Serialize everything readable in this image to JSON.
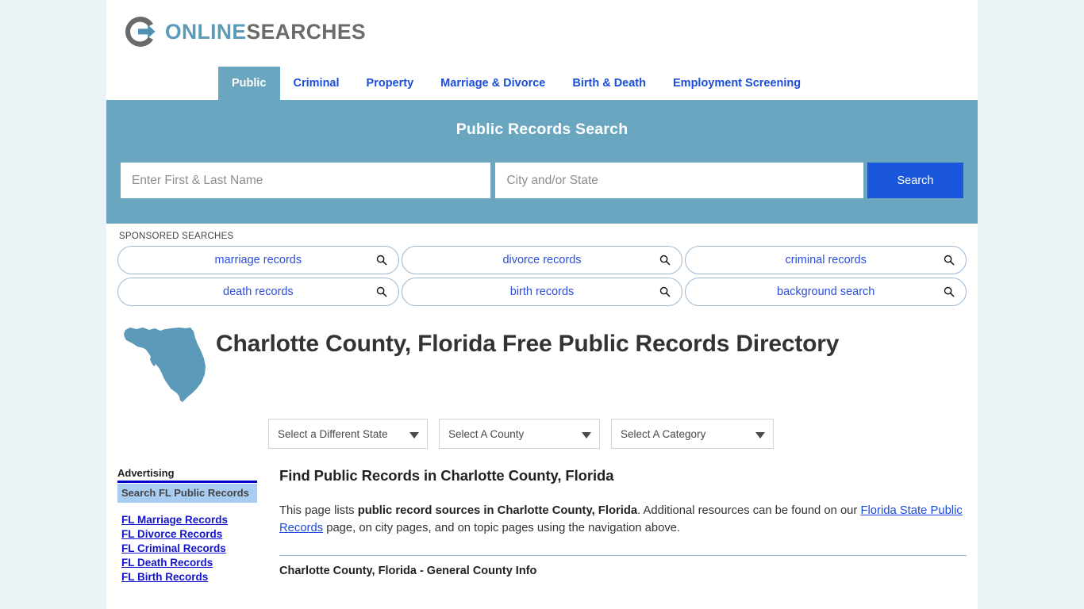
{
  "brand": {
    "logo_icon": "circle-arrow-logo-icon",
    "name_part1": "ONLINE",
    "name_part2": "SEARCHES"
  },
  "nav": {
    "items": [
      {
        "label": "Public",
        "active": true
      },
      {
        "label": "Criminal",
        "active": false
      },
      {
        "label": "Property",
        "active": false
      },
      {
        "label": "Marriage & Divorce",
        "active": false
      },
      {
        "label": "Birth & Death",
        "active": false
      },
      {
        "label": "Employment Screening",
        "active": false
      }
    ]
  },
  "search_banner": {
    "heading": "Public Records Search",
    "name_value": "",
    "name_placeholder": "Enter First & Last Name",
    "location_value": "",
    "location_placeholder": "City and/or State",
    "button_label": "Search",
    "background_color": "#6aa6c0",
    "button_color": "#1a56db"
  },
  "sponsored": {
    "label": "SPONSORED SEARCHES",
    "icon": "magnifier-icon",
    "rows": [
      [
        "marriage records",
        "divorce records",
        "criminal records"
      ],
      [
        "death records",
        "birth records",
        "background search"
      ]
    ]
  },
  "title_block": {
    "map_icon": "florida-state-map-icon",
    "map_color": "#5b9ab8",
    "title": "Charlotte County, Florida Free Public Records Directory"
  },
  "selectors": {
    "state": "Select a Different State",
    "county": "Select A County",
    "category": "Select A Category",
    "caret_icon": "chevron-down-icon"
  },
  "sidebar": {
    "advertising_label": "Advertising",
    "headline": "Search FL Public Records",
    "links": [
      "FL Marriage Records",
      "FL Divorce Records",
      "FL Criminal Records",
      "FL Death Records",
      "FL Birth Records"
    ]
  },
  "main": {
    "heading": "Find Public Records in Charlotte County, Florida",
    "paragraph": {
      "part1": "This page lists ",
      "bold1": "public record sources in Charlotte County, Florida",
      "part2": ". Additional resources can be found on our ",
      "link": "Florida State Public Records",
      "part3": " page, on city pages, and on topic pages using the navigation above."
    },
    "section_heading": "Charlotte County, Florida - General County Info"
  }
}
